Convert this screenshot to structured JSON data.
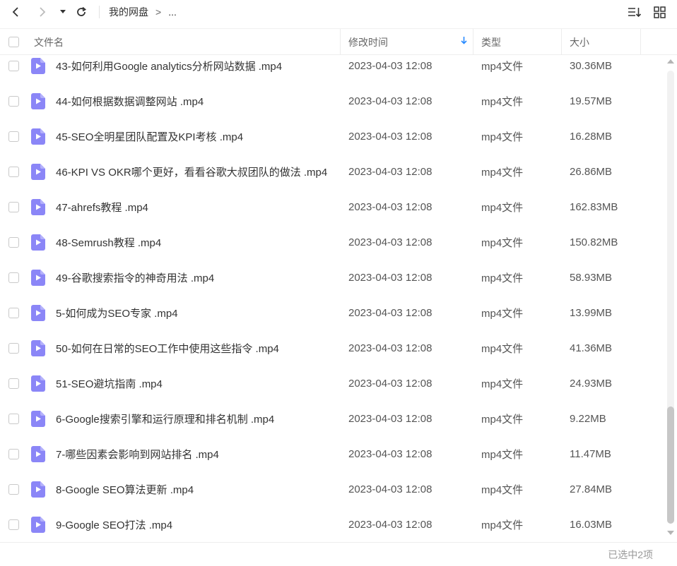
{
  "toolbar": {
    "breadcrumb_root": "我的网盘",
    "breadcrumb_separator": ">",
    "breadcrumb_more": "..."
  },
  "columns": {
    "name": "文件名",
    "mtime": "修改时间",
    "type": "类型",
    "size": "大小"
  },
  "colors": {
    "accent": "#2a8bff",
    "file_icon": "#8b86f7"
  },
  "files": [
    {
      "name": "43-如何利用Google analytics分析网站数据 .mp4",
      "mtime": "2023-04-03 12:08",
      "type": "mp4文件",
      "size": "30.36MB"
    },
    {
      "name": "44-如何根据数据调整网站 .mp4",
      "mtime": "2023-04-03 12:08",
      "type": "mp4文件",
      "size": "19.57MB"
    },
    {
      "name": "45-SEO全明星团队配置及KPI考核 .mp4",
      "mtime": "2023-04-03 12:08",
      "type": "mp4文件",
      "size": "16.28MB"
    },
    {
      "name": "46-KPI VS OKR哪个更好，看看谷歌大叔团队的做法 .mp4",
      "mtime": "2023-04-03 12:08",
      "type": "mp4文件",
      "size": "26.86MB"
    },
    {
      "name": "47-ahrefs教程 .mp4",
      "mtime": "2023-04-03 12:08",
      "type": "mp4文件",
      "size": "162.83MB"
    },
    {
      "name": "48-Semrush教程 .mp4",
      "mtime": "2023-04-03 12:08",
      "type": "mp4文件",
      "size": "150.82MB"
    },
    {
      "name": "49-谷歌搜索指令的神奇用法 .mp4",
      "mtime": "2023-04-03 12:08",
      "type": "mp4文件",
      "size": "58.93MB"
    },
    {
      "name": "5-如何成为SEO专家 .mp4",
      "mtime": "2023-04-03 12:08",
      "type": "mp4文件",
      "size": "13.99MB"
    },
    {
      "name": "50-如何在日常的SEO工作中使用这些指令 .mp4",
      "mtime": "2023-04-03 12:08",
      "type": "mp4文件",
      "size": "41.36MB"
    },
    {
      "name": "51-SEO避坑指南 .mp4",
      "mtime": "2023-04-03 12:08",
      "type": "mp4文件",
      "size": "24.93MB"
    },
    {
      "name": "6-Google搜索引擎和运行原理和排名机制 .mp4",
      "mtime": "2023-04-03 12:08",
      "type": "mp4文件",
      "size": "9.22MB"
    },
    {
      "name": "7-哪些因素会影响到网站排名 .mp4",
      "mtime": "2023-04-03 12:08",
      "type": "mp4文件",
      "size": "11.47MB"
    },
    {
      "name": "8-Google SEO算法更新 .mp4",
      "mtime": "2023-04-03 12:08",
      "type": "mp4文件",
      "size": "27.84MB"
    },
    {
      "name": "9-Google SEO打法 .mp4",
      "mtime": "2023-04-03 12:08",
      "type": "mp4文件",
      "size": "16.03MB"
    }
  ],
  "status": {
    "selected": "已选中2项"
  }
}
